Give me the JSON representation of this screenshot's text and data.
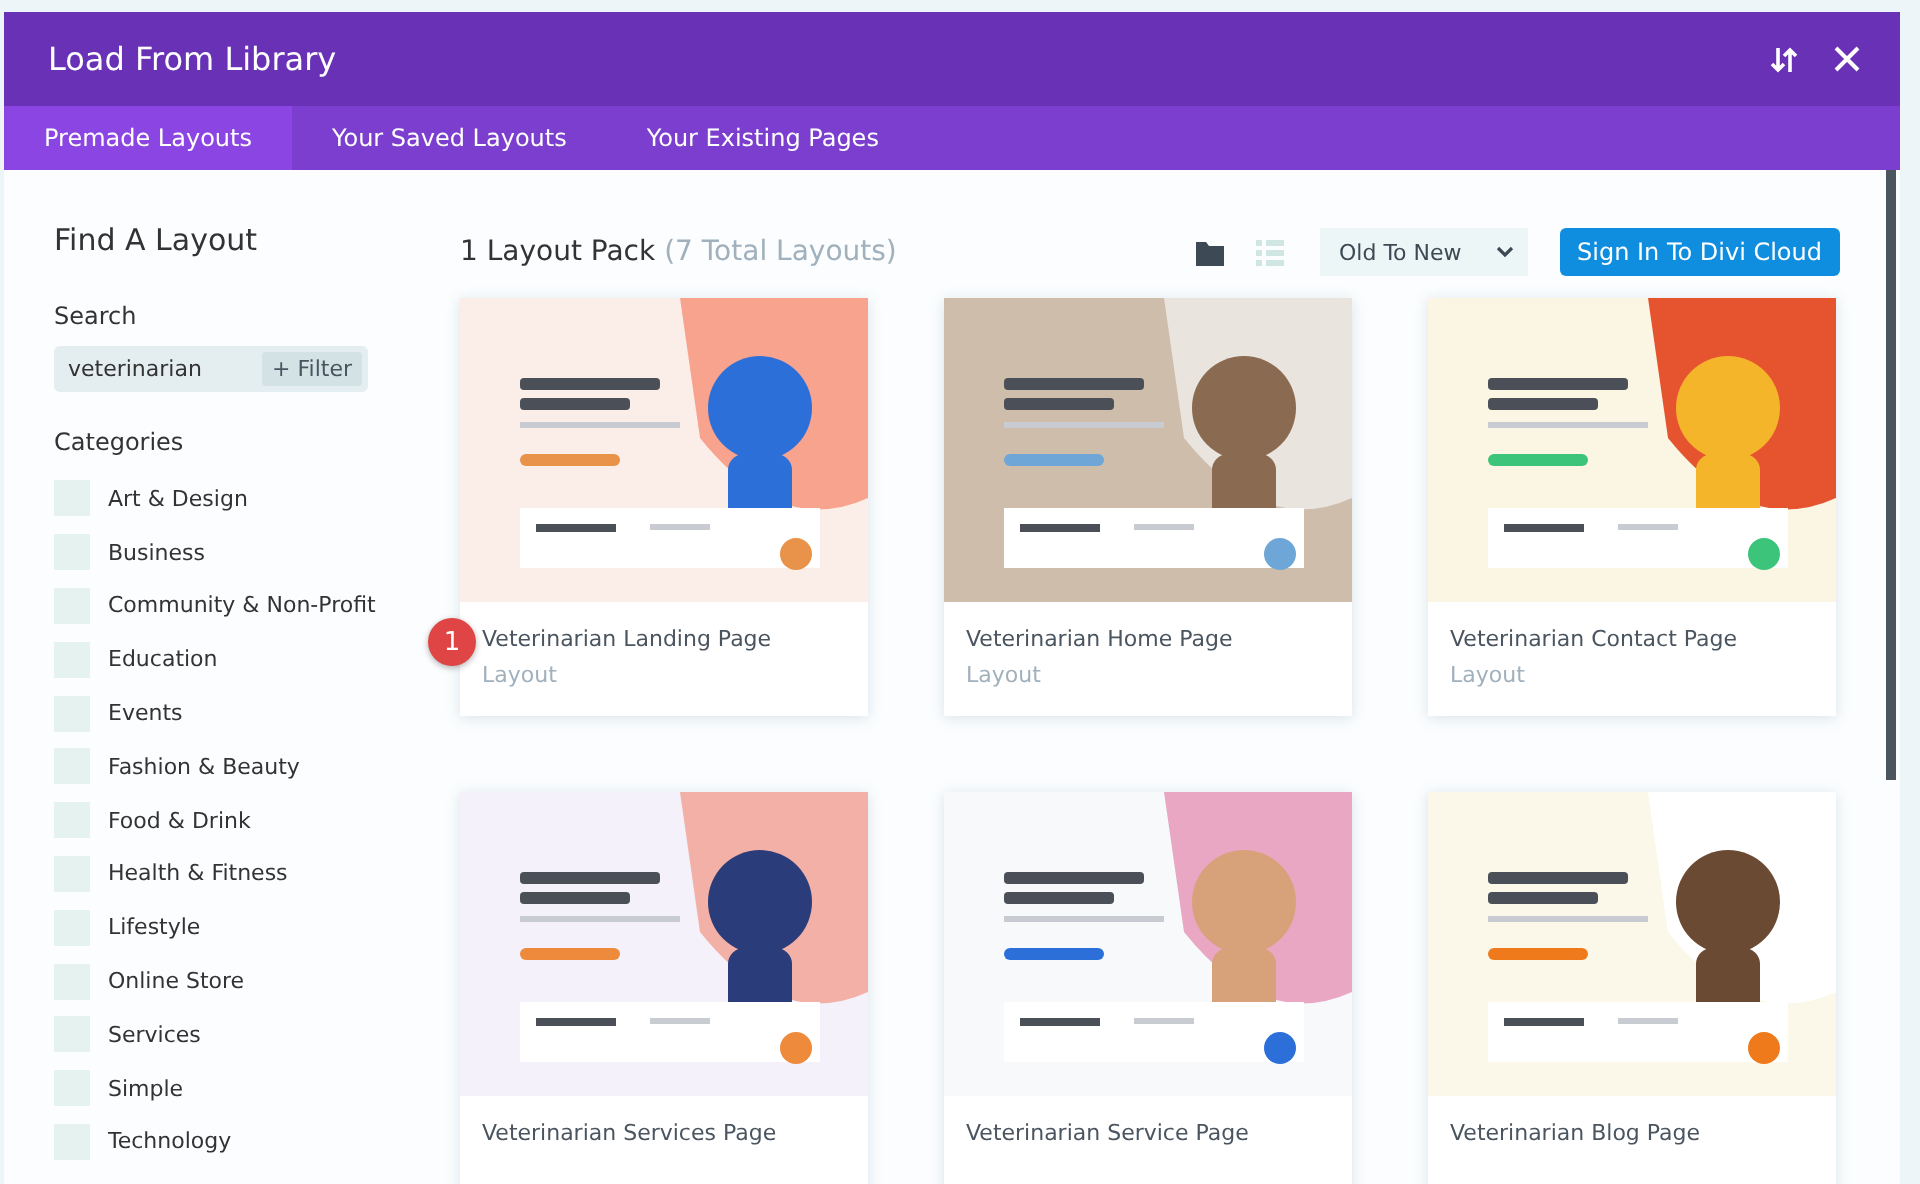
{
  "window": {
    "title": "Load From Library"
  },
  "tabs": [
    {
      "label": "Premade Layouts",
      "selected": true
    },
    {
      "label": "Your Saved Layouts",
      "selected": false
    },
    {
      "label": "Your Existing Pages",
      "selected": false
    }
  ],
  "sidebar": {
    "heading": "Find A Layout",
    "search_label": "Search",
    "search": {
      "value": "veterinarian"
    },
    "filter_button": "+ Filter",
    "categories_label": "Categories",
    "categories": [
      {
        "label": "Art & Design",
        "checked": false
      },
      {
        "label": "Business",
        "checked": false
      },
      {
        "label": "Community & Non-Profit",
        "checked": false
      },
      {
        "label": "Education",
        "checked": false
      },
      {
        "label": "Events",
        "checked": false
      },
      {
        "label": "Fashion & Beauty",
        "checked": false
      },
      {
        "label": "Food & Drink",
        "checked": false
      },
      {
        "label": "Health & Fitness",
        "checked": false
      },
      {
        "label": "Lifestyle",
        "checked": false
      },
      {
        "label": "Online Store",
        "checked": false
      },
      {
        "label": "Services",
        "checked": false
      },
      {
        "label": "Simple",
        "checked": false
      },
      {
        "label": "Technology",
        "checked": false
      }
    ]
  },
  "main": {
    "count": "1 Layout Pack",
    "total": "(7 Total Layouts)",
    "views": [
      {
        "kind": "grid",
        "selected": true
      },
      {
        "kind": "list",
        "selected": false
      }
    ],
    "sort": "Old To New",
    "sign_in_button": "Sign In To Divi Cloud",
    "cards": [
      {
        "title": "Veterinarian Landing Page",
        "subtitle": "Layout",
        "badge": "1"
      },
      {
        "title": "Veterinarian Home Page",
        "subtitle": "Layout"
      },
      {
        "title": "Veterinarian Contact Page",
        "subtitle": "Layout"
      },
      {
        "title": "Veterinarian Services Page"
      },
      {
        "title": "Veterinarian Service Page"
      },
      {
        "title": "Veterinarian Blog Page"
      }
    ]
  }
}
